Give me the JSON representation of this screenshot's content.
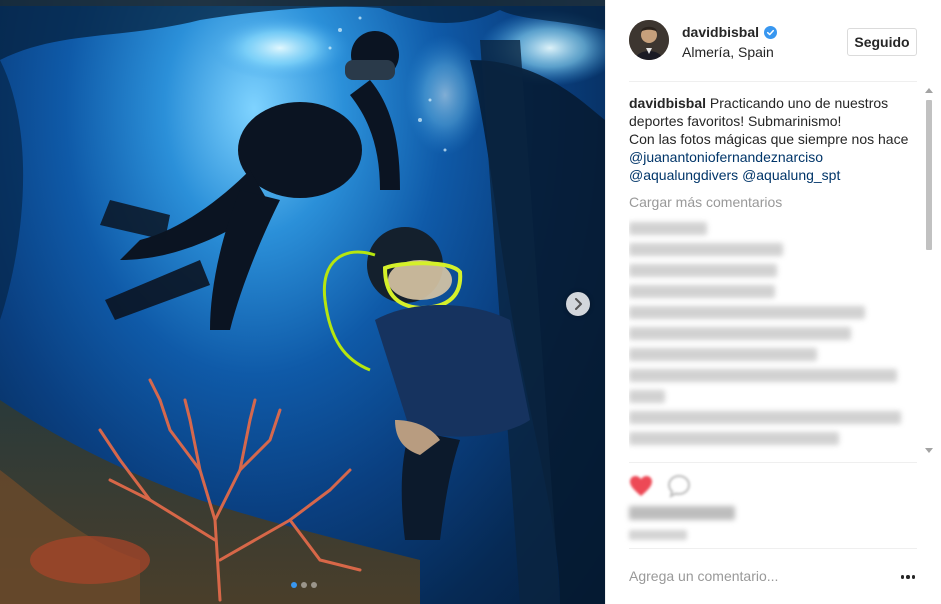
{
  "post": {
    "username": "davidbisbal",
    "location": "Almería, Spain",
    "follow_label": "Seguido",
    "caption": {
      "author": "davidbisbal",
      "text_line1": "Practicando uno de nuestros deportes favoritos! Submarinismo!",
      "text_line2": "Con las fotos mágicas que siempre nos hace",
      "mentions": [
        "@juanantoniofernandeznarciso",
        "@aqualungdivers",
        "@aqualung_spt"
      ]
    },
    "load_more_label": "Cargar más comentarios",
    "add_comment_placeholder": "Agrega un comentario..."
  },
  "carousel": {
    "total": 3,
    "active": 1
  },
  "icons": {
    "verified": "verified-badge-icon",
    "next": "chevron-right-icon",
    "like": "heart-icon",
    "comment": "comment-icon",
    "more": "more-options-icon"
  },
  "colors": {
    "accent": "#3897f0",
    "mention": "#003569",
    "muted": "#999999",
    "like_red": "#ed4956"
  }
}
